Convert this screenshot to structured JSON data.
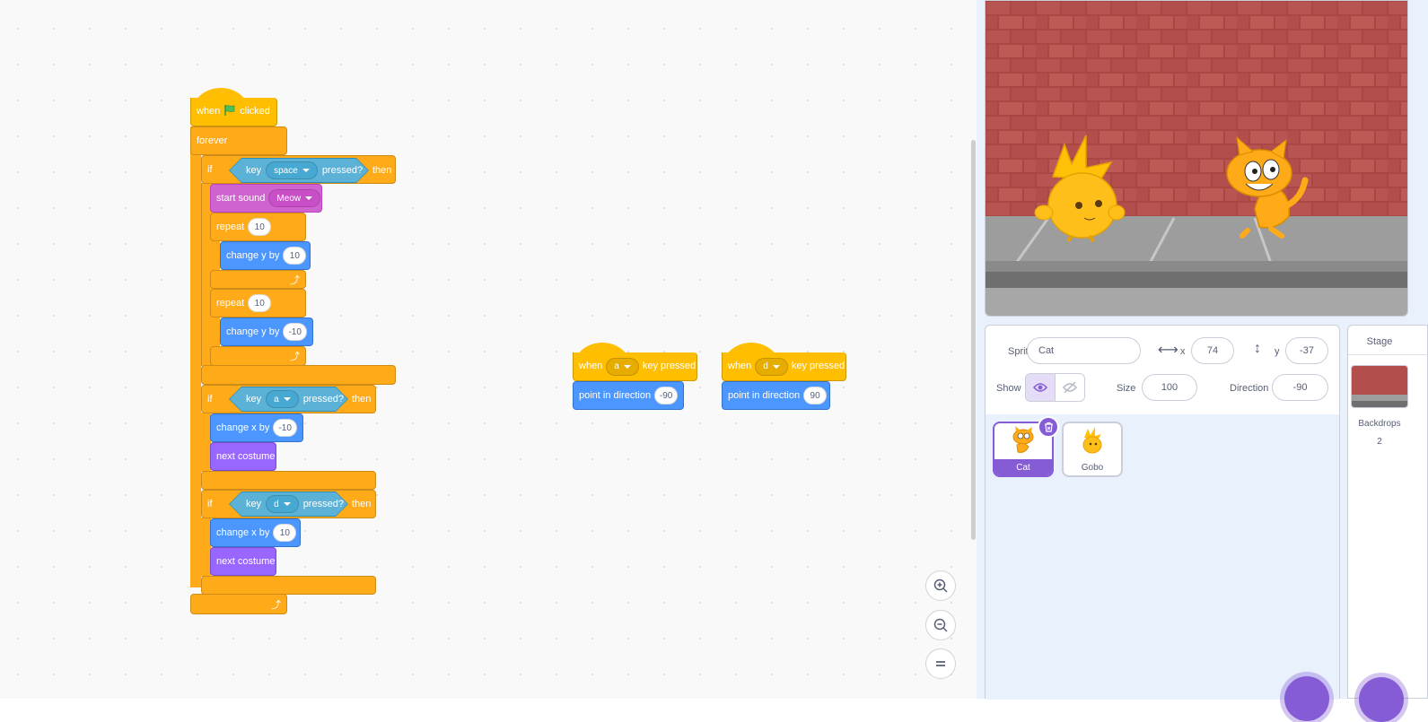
{
  "code": {
    "script1": {
      "when": "when",
      "clicked": "clicked",
      "forever": "forever",
      "if1": {
        "if": "if",
        "key": "key",
        "key_value": "space",
        "pressed": "pressed?",
        "then": "then"
      },
      "start_sound": "start sound",
      "sound_value": "Meow",
      "repeat1": {
        "label": "repeat",
        "value": "10"
      },
      "change_y1": {
        "label": "change y by",
        "value": "10"
      },
      "repeat2": {
        "label": "repeat",
        "value": "10"
      },
      "change_y2": {
        "label": "change y by",
        "value": "-10"
      },
      "if2": {
        "if": "if",
        "key": "key",
        "key_value": "a",
        "pressed": "pressed?",
        "then": "then"
      },
      "change_x1": {
        "label": "change x by",
        "value": "-10"
      },
      "next_costume1": "next costume",
      "if3": {
        "if": "if",
        "key": "key",
        "key_value": "d",
        "pressed": "pressed?",
        "then": "then"
      },
      "change_x2": {
        "label": "change x by",
        "value": "10"
      },
      "next_costume2": "next costume"
    },
    "script2": {
      "when": "when",
      "key_value": "a",
      "key_pressed": "key pressed",
      "point": "point in direction",
      "value": "-90"
    },
    "script3": {
      "when": "when",
      "key_value": "d",
      "key_pressed": "key pressed",
      "point": "point in direction",
      "value": "90"
    }
  },
  "zoom": {
    "zoom_in_icon": "zoom-in-icon",
    "zoom_out_icon": "zoom-out-icon",
    "reset_icon": "zoom-reset-icon"
  },
  "sprite_info": {
    "sprite_label": "Sprite",
    "sprite_name": "Cat",
    "x_label": "x",
    "x_value": "74",
    "y_label": "y",
    "y_value": "-37",
    "show_label": "Show",
    "size_label": "Size",
    "size_value": "100",
    "direction_label": "Direction",
    "direction_value": "-90"
  },
  "sprites": [
    {
      "name": "Cat",
      "selected": true
    },
    {
      "name": "Gobo",
      "selected": false
    }
  ],
  "stage_pane": {
    "title": "Stage",
    "backdrops_label": "Backdrops",
    "backdrops_count": "2"
  },
  "colors": {
    "events": "#ffbf00",
    "control": "#ffab19",
    "motion": "#4c97ff",
    "sound": "#cf63cf",
    "looks": "#9966ff",
    "sensing": "#5cb1d6",
    "accent": "#855cd6"
  }
}
